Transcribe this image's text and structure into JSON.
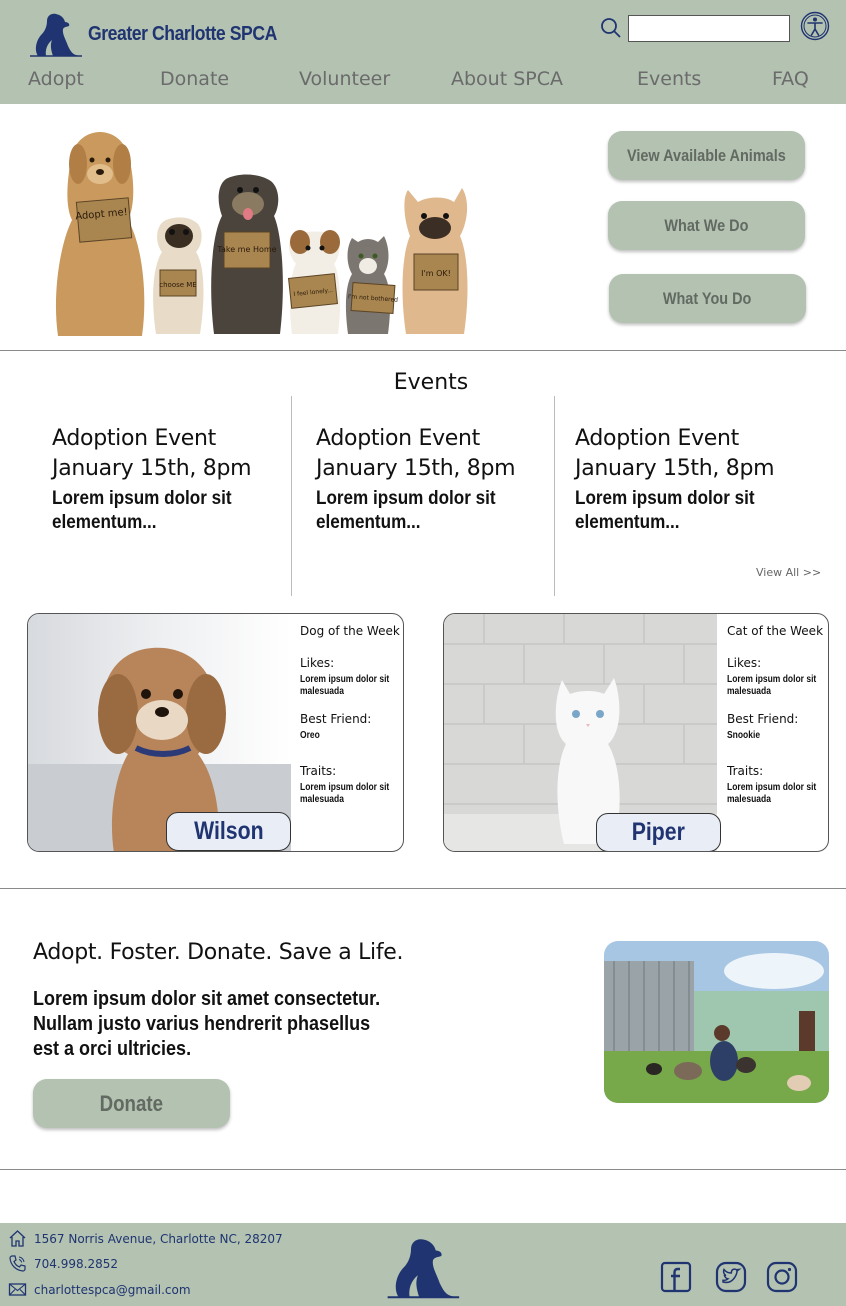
{
  "header": {
    "brand_name": "Greater Charlotte SPCA",
    "search": {
      "value": "",
      "placeholder": ""
    },
    "nav": [
      "Adopt",
      "Donate",
      "Volunteer",
      "About SPCA",
      "Events",
      "FAQ"
    ]
  },
  "hero": {
    "sign_texts": [
      "Adopt me!",
      "choose ME",
      "Take me Home",
      "I feel lonely...",
      "I'm not bothered",
      "I'm OK!"
    ],
    "buttons": [
      "View Available Animals",
      "What We Do",
      "What You Do"
    ]
  },
  "events": {
    "title": "Events",
    "items": [
      {
        "name": "Adoption Event",
        "date": "January 15th, 8pm",
        "desc": "Lorem ipsum dolor sit elementum..."
      },
      {
        "name": "Adoption Event",
        "date": "January 15th, 8pm",
        "desc": "Lorem ipsum dolor sit elementum..."
      },
      {
        "name": "Adoption Event",
        "date": "January 15th, 8pm",
        "desc": "Lorem ipsum dolor sit elementum..."
      }
    ],
    "view_all": "View All >>"
  },
  "pets": [
    {
      "heading": "Dog of the Week",
      "likes_label": "Likes:",
      "likes": "Lorem ipsum dolor sit malesuada",
      "friend_label": "Best Friend:",
      "friend": "Oreo",
      "traits_label": "Traits:",
      "traits": "Lorem ipsum dolor sit malesuada",
      "name": "Wilson"
    },
    {
      "heading": "Cat of the Week",
      "likes_label": "Likes:",
      "likes": "Lorem ipsum dolor sit malesuada",
      "friend_label": "Best Friend:",
      "friend": "Snookie",
      "traits_label": "Traits:",
      "traits": "Lorem ipsum dolor sit malesuada",
      "name": "Piper"
    }
  ],
  "mission": {
    "title": "Adopt. Foster. Donate. Save a Life.",
    "text": "Lorem ipsum dolor sit amet consectetur. Nullam justo varius hendrerit phasellus est a orci ultricies.",
    "button": "Donate"
  },
  "footer": {
    "address": "1567 Norris Avenue, Charlotte NC, 28207",
    "phone": "704.998.2852",
    "email": "charlottespca@gmail.com"
  },
  "colors": {
    "sage": "#b3c2b1",
    "navy": "#1f3471",
    "button_text": "#626a62",
    "nametag": "#e9edf6"
  },
  "icons": [
    "dog-cat-logo-icon",
    "search-icon",
    "accessibility-icon",
    "home-icon",
    "phone-icon",
    "mail-icon",
    "facebook-icon",
    "twitter-icon",
    "instagram-icon"
  ]
}
